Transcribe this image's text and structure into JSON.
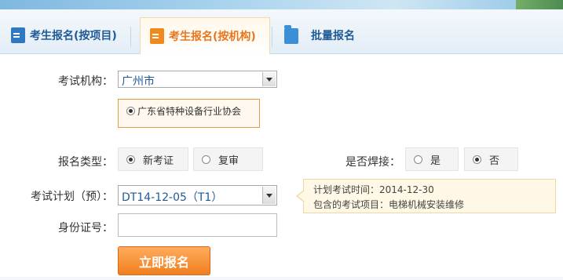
{
  "tabs": [
    {
      "label": "考生报名(按项目)"
    },
    {
      "label": "考生报名(按机构)"
    },
    {
      "label": "批量报名"
    }
  ],
  "form": {
    "org_label": "考试机构：",
    "org_value": "广州市",
    "org_option": "广东省特种设备行业协会",
    "type_label": "报名类型：",
    "type_options": [
      "新考证",
      "复审"
    ],
    "weld_label": "是否焊接：",
    "weld_options": [
      "是",
      "否"
    ],
    "plan_label": "考试计划（预）：",
    "plan_value": "DT14-12-05（T1）",
    "id_label": "身份证号：",
    "id_value": "",
    "submit_label": "立即报名"
  },
  "tip": {
    "line1": "计划考试时间：2014-12-30",
    "line2": "包含的考试项目：电梯机械安装维修"
  }
}
